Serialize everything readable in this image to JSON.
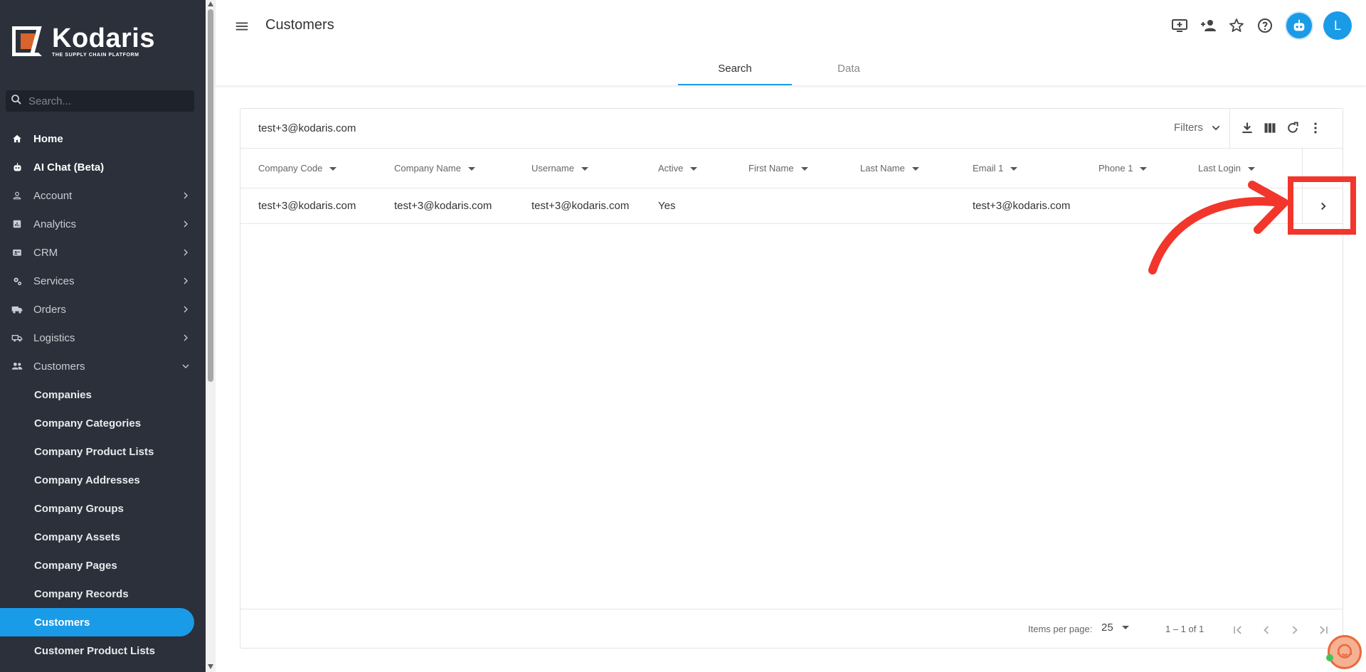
{
  "brand": {
    "name": "Kodaris",
    "tagline": "THE SUPPLY CHAIN PLATFORM",
    "accent": "#1a9be8",
    "logo_orange": "#d9642b"
  },
  "sidebar": {
    "search_placeholder": "Search...",
    "items": [
      {
        "label": "Home",
        "icon": "home-icon",
        "bold": true
      },
      {
        "label": "AI Chat (Beta)",
        "icon": "robot-icon",
        "bold": true
      },
      {
        "label": "Account",
        "icon": "person-icon",
        "expandable": true
      },
      {
        "label": "Analytics",
        "icon": "analytics-icon",
        "expandable": true
      },
      {
        "label": "CRM",
        "icon": "contact-card-icon",
        "expandable": true
      },
      {
        "label": "Services",
        "icon": "gears-icon",
        "expandable": true
      },
      {
        "label": "Orders",
        "icon": "truck-icon",
        "expandable": true
      },
      {
        "label": "Logistics",
        "icon": "shipping-icon",
        "expandable": true
      },
      {
        "label": "Customers",
        "icon": "people-icon",
        "expanded": true
      }
    ],
    "sub_items": [
      {
        "label": "Companies"
      },
      {
        "label": "Company Categories"
      },
      {
        "label": "Company Product Lists"
      },
      {
        "label": "Company Addresses"
      },
      {
        "label": "Company Groups"
      },
      {
        "label": "Company Assets"
      },
      {
        "label": "Company Pages"
      },
      {
        "label": "Company Records"
      },
      {
        "label": "Customers",
        "active": true
      },
      {
        "label": "Customer Product Lists"
      }
    ]
  },
  "header": {
    "title": "Customers",
    "avatar_initial": "L",
    "icons": [
      "add-screen-icon",
      "add-person-icon",
      "star-icon",
      "help-icon",
      "robot-icon"
    ],
    "tabs": [
      {
        "label": "Search",
        "active": true
      },
      {
        "label": "Data",
        "active": false
      }
    ]
  },
  "table": {
    "query": "test+3@kodaris.com",
    "filters_label": "Filters",
    "tools": [
      "download-icon",
      "columns-icon",
      "refresh-icon",
      "more-vert-icon"
    ],
    "columns": [
      "Company Code",
      "Company Name",
      "Username",
      "Active",
      "First Name",
      "Last Name",
      "Email 1",
      "Phone 1",
      "Last Login"
    ],
    "rows": [
      [
        "test+3@kodaris.com",
        "test+3@kodaris.com",
        "test+3@kodaris.com",
        "Yes",
        "",
        "",
        "test+3@kodaris.com",
        "",
        ""
      ]
    ]
  },
  "paginator": {
    "items_per_page_label": "Items per page:",
    "items_per_page": "25",
    "range": "1 – 1 of 1"
  },
  "annotation": {
    "color": "#f2362b"
  }
}
